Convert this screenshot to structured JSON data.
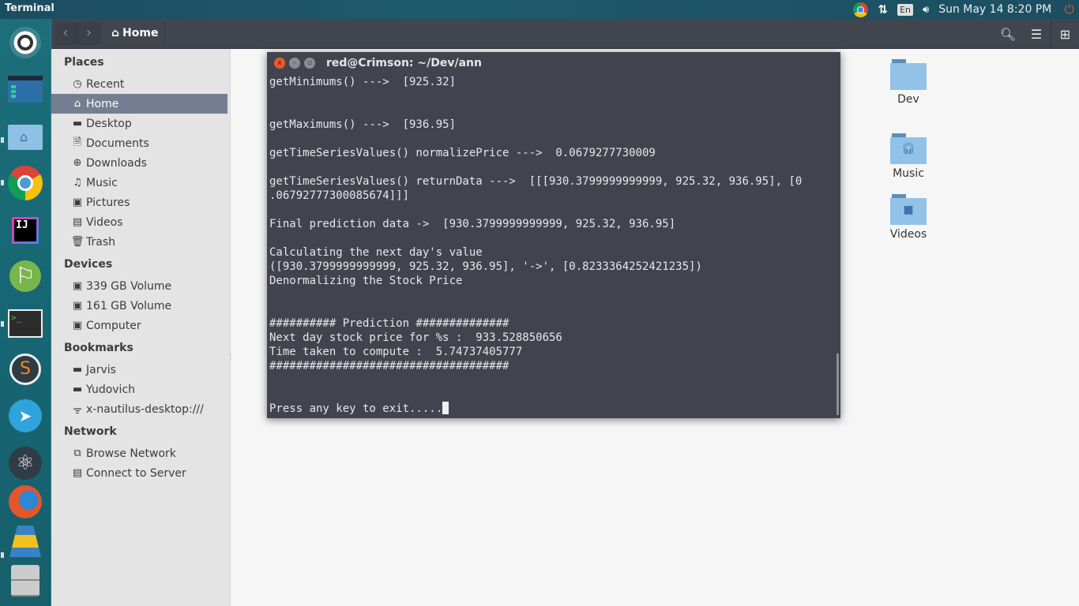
{
  "top_panel": {
    "app_title": "Terminal",
    "tray": {
      "browser_icon": "chrome-icon",
      "network_icon": "network-arrows-icon",
      "keyboard_layout": "En",
      "volume_icon": "volume-icon",
      "clock": "Sun May 14  8:20 PM",
      "power_icon": "power-icon"
    }
  },
  "launcher": {
    "items": [
      {
        "name": "ubuntu-dash",
        "running": false
      },
      {
        "name": "files-app",
        "running": false
      },
      {
        "name": "home-folder",
        "running": true
      },
      {
        "name": "chrome",
        "running": true
      },
      {
        "name": "intellij-idea",
        "running": false
      },
      {
        "name": "android-studio",
        "running": false
      },
      {
        "name": "terminal",
        "running": true
      },
      {
        "name": "sublime-text",
        "running": false
      },
      {
        "name": "telegram",
        "running": false
      },
      {
        "name": "atom",
        "running": false
      },
      {
        "name": "firefox",
        "running": false
      },
      {
        "name": "software-installer",
        "running": true
      },
      {
        "name": "drive",
        "running": false
      }
    ]
  },
  "file_manager": {
    "path_button": "Home",
    "sidebar": {
      "sections": [
        {
          "heading": "Places",
          "items": [
            {
              "label": "Recent",
              "icon": "clock-icon"
            },
            {
              "label": "Home",
              "icon": "home-icon",
              "active": true
            },
            {
              "label": "Desktop",
              "icon": "folder-icon"
            },
            {
              "label": "Documents",
              "icon": "document-icon"
            },
            {
              "label": "Downloads",
              "icon": "download-icon"
            },
            {
              "label": "Music",
              "icon": "music-icon"
            },
            {
              "label": "Pictures",
              "icon": "picture-icon"
            },
            {
              "label": "Videos",
              "icon": "film-icon"
            },
            {
              "label": "Trash",
              "icon": "trash-icon"
            }
          ]
        },
        {
          "heading": "Devices",
          "items": [
            {
              "label": "339 GB Volume",
              "icon": "drive-icon"
            },
            {
              "label": "161 GB Volume",
              "icon": "drive-icon"
            },
            {
              "label": "Computer",
              "icon": "drive-icon"
            }
          ]
        },
        {
          "heading": "Bookmarks",
          "items": [
            {
              "label": "Jarvis",
              "icon": "folder-icon"
            },
            {
              "label": "Yudovich",
              "icon": "folder-icon"
            },
            {
              "label": "x-nautilus-desktop:///",
              "icon": "network-share-icon"
            }
          ]
        },
        {
          "heading": "Network",
          "items": [
            {
              "label": "Browse Network",
              "icon": "network-icon"
            },
            {
              "label": "Connect to Server",
              "icon": "server-icon"
            }
          ]
        }
      ]
    },
    "files": [
      {
        "label": "Dev",
        "emblem": ""
      },
      {
        "label": "Music",
        "emblem": "headphones"
      },
      {
        "label": "Videos",
        "emblem": "camera"
      }
    ]
  },
  "terminal": {
    "title": "red@Crimson: ~/Dev/ann",
    "lines": [
      "getMinimums() --->  [925.32]",
      "",
      "",
      "getMaximums() --->  [936.95]",
      "",
      "getTimeSeriesValues() normalizePrice --->  0.0679277730009",
      "",
      "getTimeSeriesValues() returnData --->  [[[930.3799999999999, 925.32, 936.95], [0",
      ".06792777300085674]]]",
      "",
      "Final prediction data ->  [930.3799999999999, 925.32, 936.95]",
      "",
      "Calculating the next day's value",
      "([930.3799999999999, 925.32, 936.95], '->', [0.8233364252421235])",
      "Denormalizing the Stock Price",
      "",
      "",
      "########## Prediction ##############",
      "Next day stock price for %s :  933.528850656",
      "Time taken to compute :  5.74737405777",
      "####################################",
      "",
      "",
      "Press any key to exit....."
    ]
  }
}
